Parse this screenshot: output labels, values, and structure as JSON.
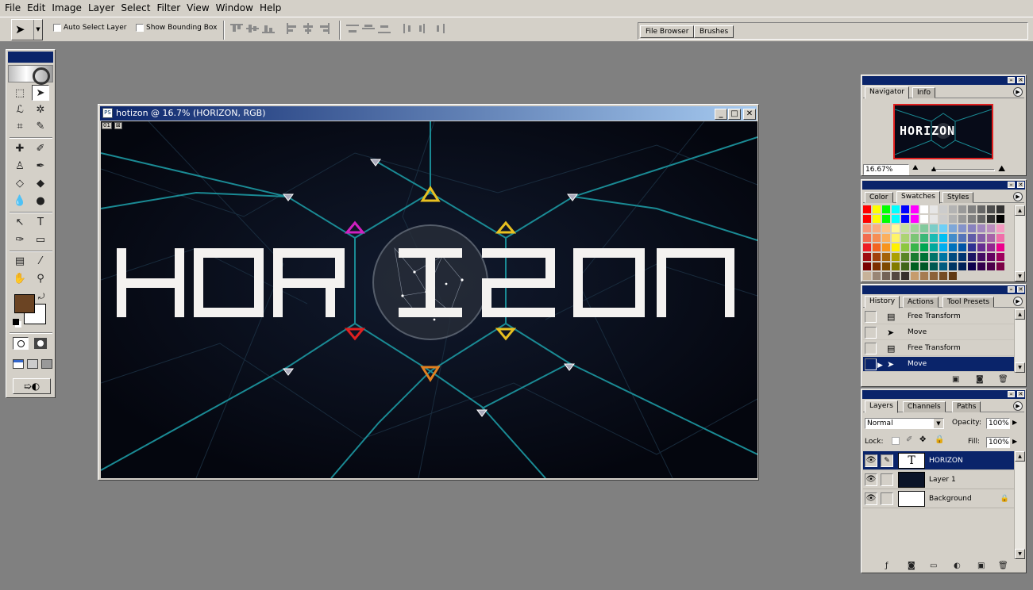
{
  "menubar": [
    "File",
    "Edit",
    "Image",
    "Layer",
    "Select",
    "Filter",
    "View",
    "Window",
    "Help"
  ],
  "options": {
    "auto_select_layer": "Auto Select Layer",
    "show_bounding_box": "Show Bounding Box",
    "well_tabs": [
      "File Browser",
      "Brushes"
    ]
  },
  "document": {
    "title": "hotizon @ 16.7% (HORIZON, RGB)",
    "ruler_marks": [
      "01",
      "⊠"
    ],
    "artwork_text": "HORIZON"
  },
  "navigator": {
    "tabs": [
      "Navigator",
      "Info"
    ],
    "zoom": "16.67%",
    "preview_text": "HORIZON"
  },
  "swatches": {
    "tabs": [
      "Color",
      "Swatches",
      "Styles"
    ],
    "colors": [
      "#ff0000",
      "#ffff00",
      "#00ff00",
      "#00ffff",
      "#0000ff",
      "#ff00ff",
      "#ffffff",
      "#e6e6e6",
      "#cccccc",
      "#b3b3b3",
      "#999999",
      "#808080",
      "#666666",
      "#4d4d4d",
      "#333333",
      "#ff0000",
      "#ffff00",
      "#00ff00",
      "#00ffff",
      "#0000ff",
      "#ff00ff",
      "#ffffff",
      "#e6e6e6",
      "#cccccc",
      "#b3b3b3",
      "#999999",
      "#808080",
      "#666666",
      "#333333",
      "#000000",
      "#f7977a",
      "#f9ad81",
      "#fdc68a",
      "#fff79a",
      "#c4df9b",
      "#a2d39c",
      "#82ca9d",
      "#7bcdc8",
      "#6ecff6",
      "#7ea7d8",
      "#8493ca",
      "#8882be",
      "#a187be",
      "#bc8dbf",
      "#f49ac2",
      "#f26c4f",
      "#f68e55",
      "#fbaf5c",
      "#fff467",
      "#acd372",
      "#7cc576",
      "#3bb878",
      "#1abbb4",
      "#00bff3",
      "#438cca",
      "#5574b9",
      "#605ca8",
      "#855fa8",
      "#a763a8",
      "#f06eaa",
      "#ed1c24",
      "#f26522",
      "#f7941d",
      "#fff200",
      "#8dc73f",
      "#39b54a",
      "#00a651",
      "#00a99d",
      "#00aeef",
      "#0072bc",
      "#0054a6",
      "#2e3192",
      "#662d91",
      "#92278f",
      "#ec008c",
      "#9e0b0f",
      "#a0410d",
      "#a36209",
      "#aba000",
      "#598527",
      "#1a7b30",
      "#007236",
      "#00746b",
      "#0076a3",
      "#004b80",
      "#003471",
      "#1b1464",
      "#440e62",
      "#630460",
      "#9e005d",
      "#790000",
      "#7b2e00",
      "#7d4900",
      "#827b00",
      "#406618",
      "#005e20",
      "#005826",
      "#005952",
      "#005b7f",
      "#003663",
      "#002157",
      "#0d004c",
      "#32004b",
      "#4b0049",
      "#7b0046",
      "#c7b299",
      "#998675",
      "#736357",
      "#534741",
      "#37302d",
      "#c69c6d",
      "#a67c52",
      "#8c6239",
      "#754c24",
      "#603913"
    ]
  },
  "history": {
    "tabs": [
      "History",
      "Actions",
      "Tool Presets"
    ],
    "items": [
      "Free Transform",
      "Move",
      "Free Transform",
      "Move"
    ]
  },
  "layers": {
    "tabs": [
      "Layers",
      "Channels",
      "Paths"
    ],
    "blend_mode": "Normal",
    "opacity_label": "Opacity:",
    "opacity": "100%",
    "lock_label": "Lock:",
    "fill_label": "Fill:",
    "fill": "100%",
    "items": [
      "HORIZON",
      "Layer 1",
      "Background"
    ]
  },
  "colors": {
    "foreground": "#6b4423",
    "background": "#ffffff",
    "accent_teal": "#1a8a94",
    "title_blue": "#0a246a"
  }
}
